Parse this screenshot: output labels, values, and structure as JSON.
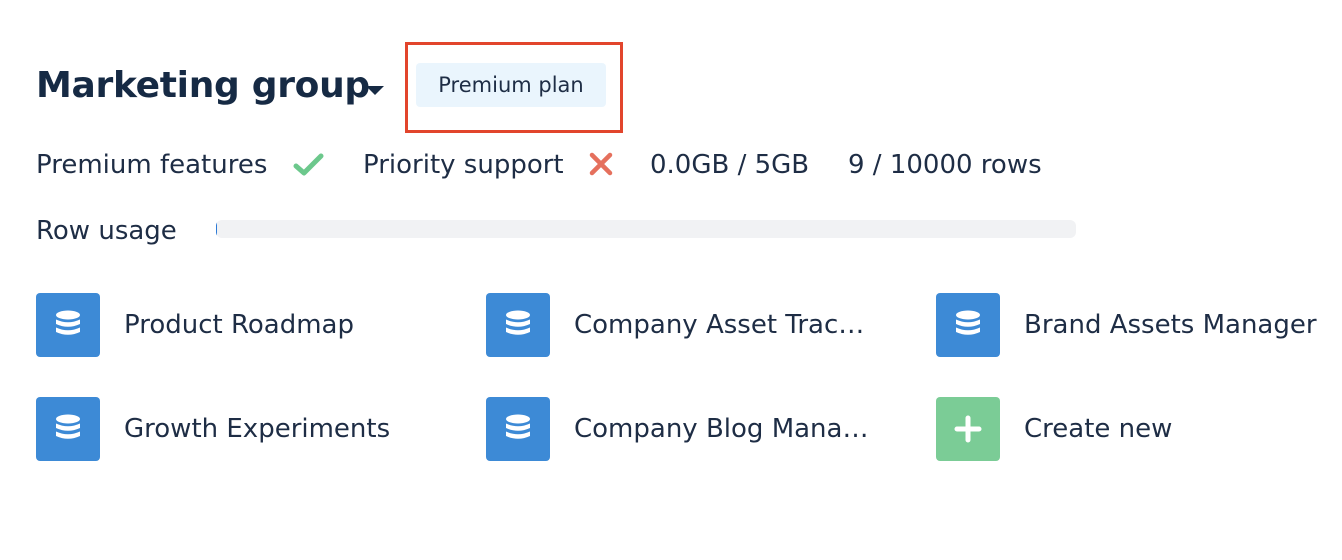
{
  "group": {
    "title": "Marketing group",
    "plan_badge": "Premium plan"
  },
  "features": {
    "premium_features_label": "Premium features",
    "premium_features_enabled": true,
    "priority_support_label": "Priority support",
    "priority_support_enabled": false,
    "storage": "0.0GB / 5GB",
    "rows": "9 / 10000 rows"
  },
  "row_usage": {
    "label": "Row usage",
    "fraction": 0.0009
  },
  "databases": [
    {
      "label": "Product Roadmap",
      "icon": "database-icon"
    },
    {
      "label": "Company Asset Tracker",
      "icon": "database-icon"
    },
    {
      "label": "Brand Assets Manager",
      "icon": "database-icon"
    },
    {
      "label": "Growth Experiments",
      "icon": "database-icon"
    },
    {
      "label": "Company Blog Manage…",
      "icon": "database-icon"
    }
  ],
  "create_new": {
    "label": "Create new",
    "icon": "plus-icon"
  },
  "colors": {
    "title": "#162a44",
    "text": "#1e2d45",
    "highlight_border": "#e2452c",
    "badge_bg": "#eaf5fd",
    "check": "#6cc88c",
    "cross": "#e5705d",
    "db_icon_bg": "#3d8ad6",
    "create_icon_bg": "#7bcc96",
    "track_bg": "#f1f2f4"
  }
}
